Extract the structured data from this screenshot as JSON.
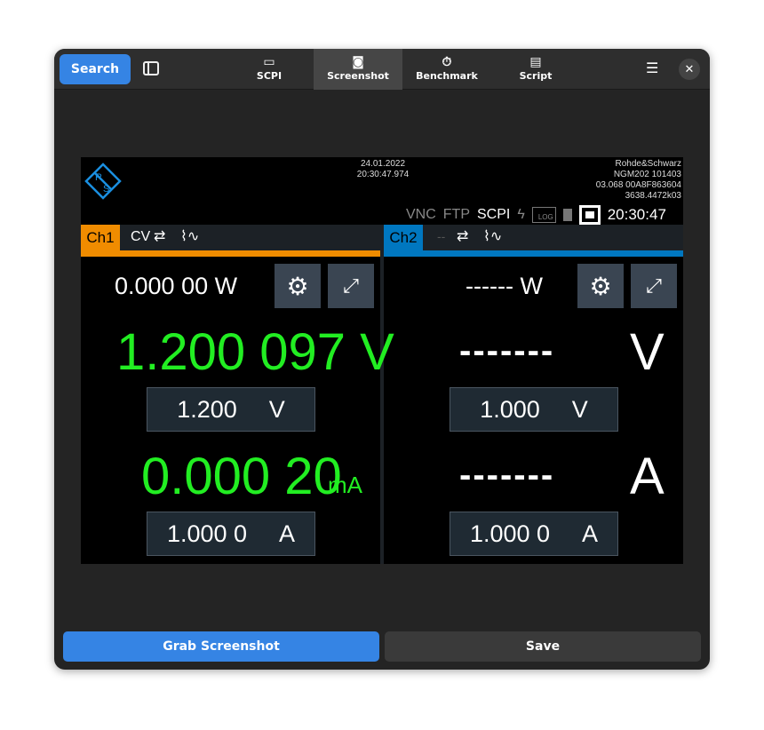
{
  "header": {
    "search_label": "Search",
    "tabs": [
      {
        "label": "SCPI",
        "icon": "terminal-icon"
      },
      {
        "label": "Screenshot",
        "icon": "camera-icon"
      },
      {
        "label": "Benchmark",
        "icon": "stopwatch-icon"
      },
      {
        "label": "Script",
        "icon": "clipboard-icon"
      }
    ],
    "active_tab": "Screenshot"
  },
  "instrument": {
    "date": "24.01.2022",
    "time": "20:30:47.974",
    "info": [
      "Rohde&Schwarz",
      "NGM202 101403",
      "03.068 00A8F863604",
      "3638.4472k03"
    ],
    "status": {
      "vnc": "VNC",
      "ftp": "FTP",
      "scpi": "SCPI",
      "log": "LOG",
      "clock": "20:30:47"
    },
    "ch1": {
      "label": "Ch1",
      "mode": "CV",
      "power": "0.000 00 W",
      "voltage": "1.200 097 V",
      "current": "0.000 20",
      "current_unit": "mA",
      "set_voltage": "1.200",
      "set_voltage_unit": "V",
      "set_current": "1.000 0",
      "set_current_unit": "A",
      "color": "#f08c00"
    },
    "ch2": {
      "label": "Ch2",
      "mode": "--",
      "power": "------ W",
      "voltage": "-------",
      "voltage_unit": "V",
      "current": "-------",
      "current_unit": "A",
      "set_voltage": "1.000",
      "set_voltage_unit": "V",
      "set_current": "1.000 0",
      "set_current_unit": "A",
      "color": "#0077c0"
    },
    "reading_color": "#22ee22"
  },
  "footer": {
    "grab_label": "Grab Screenshot",
    "save_label": "Save"
  }
}
